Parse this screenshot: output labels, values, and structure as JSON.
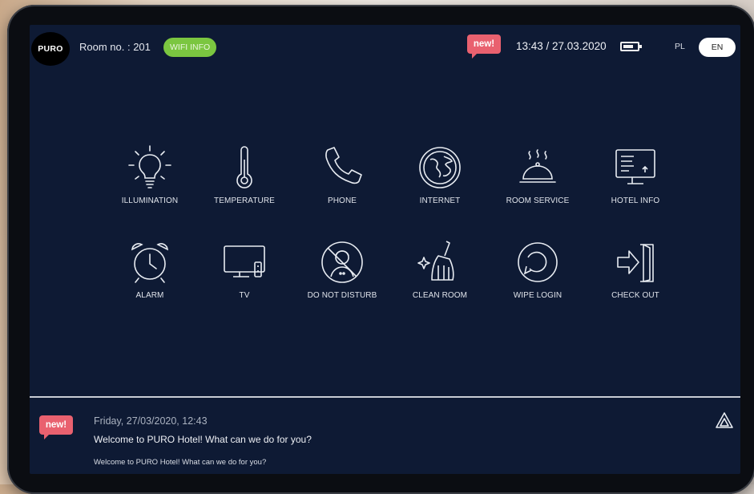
{
  "header": {
    "logo": "PURO",
    "room_label": "Room no. : 201",
    "wifi_label": "WIFI INFO",
    "new_badge": "new!",
    "datetime": "13:43 / 27.03.2020",
    "lang_inactive": "PL",
    "lang_active": "EN"
  },
  "tiles": [
    {
      "label": "ILLUMINATION",
      "icon": "bulb-icon"
    },
    {
      "label": "TEMPERATURE",
      "icon": "thermometer-icon"
    },
    {
      "label": "PHONE",
      "icon": "phone-icon"
    },
    {
      "label": "INTERNET",
      "icon": "globe-icon"
    },
    {
      "label": "ROOM SERVICE",
      "icon": "cloche-icon"
    },
    {
      "label": "HOTEL INFO",
      "icon": "monitor-info-icon"
    },
    {
      "label": "ALARM",
      "icon": "alarm-clock-icon"
    },
    {
      "label": "TV",
      "icon": "tv-icon"
    },
    {
      "label": "DO NOT DISTURB",
      "icon": "do-not-disturb-icon"
    },
    {
      "label": "CLEAN ROOM",
      "icon": "broom-icon"
    },
    {
      "label": "WIPE LOGIN",
      "icon": "refresh-icon"
    },
    {
      "label": "CHECK OUT",
      "icon": "exit-door-icon"
    }
  ],
  "message": {
    "badge": "new!",
    "date": "Friday, 27/03/2020, 12:43",
    "title": "Welcome to PURO Hotel! What can we do for you?",
    "body": "Welcome to PURO Hotel! What can we do for you?"
  },
  "colors": {
    "screen_bg": "#0e1a34",
    "wifi_green": "#7bc640",
    "badge_pink": "#e9616f"
  }
}
